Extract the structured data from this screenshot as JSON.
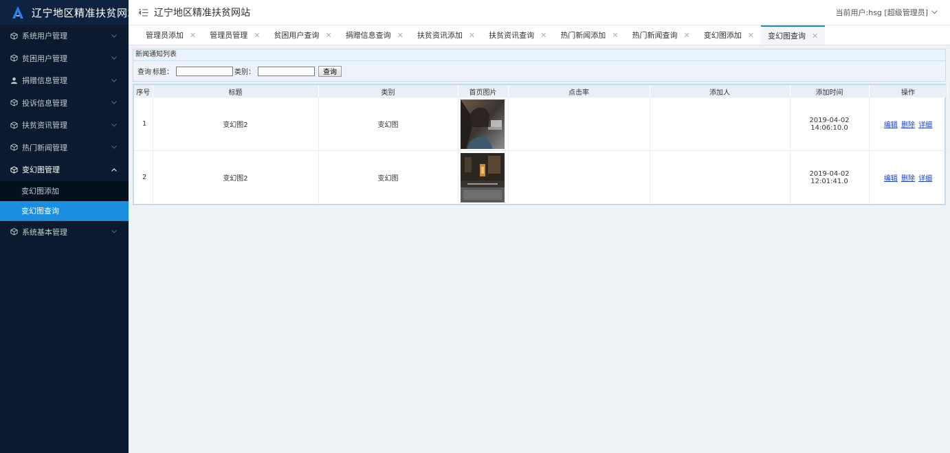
{
  "app": {
    "logo_text": "辽宁地区精准扶贫网站",
    "header_title": "辽宁地区精准扶贫网站",
    "user_info": "当前用户:hsg [超级管理员]"
  },
  "sidebar": {
    "items": [
      {
        "label": "系统用户管理",
        "icon": "cube-icon"
      },
      {
        "label": "贫困用户管理",
        "icon": "cube-icon"
      },
      {
        "label": "捐赠信息管理",
        "icon": "user-icon"
      },
      {
        "label": "投诉信息管理",
        "icon": "cube-icon"
      },
      {
        "label": "扶贫资讯管理",
        "icon": "cube-icon"
      },
      {
        "label": "热门新闻管理",
        "icon": "cube-icon"
      },
      {
        "label": "变幻图管理",
        "icon": "cube-icon",
        "open": true
      },
      {
        "label": "系统基本管理",
        "icon": "cube-icon"
      }
    ],
    "submenu": [
      {
        "label": "变幻图添加"
      },
      {
        "label": "变幻图查询"
      }
    ]
  },
  "tabs": [
    {
      "label": "管理员添加"
    },
    {
      "label": "管理员管理"
    },
    {
      "label": "贫困用户查询"
    },
    {
      "label": "捐赠信息查询"
    },
    {
      "label": "扶贫资讯添加"
    },
    {
      "label": "扶贫资讯查询"
    },
    {
      "label": "热门新闻添加"
    },
    {
      "label": "热门新闻查询"
    },
    {
      "label": "变幻图添加"
    },
    {
      "label": "变幻图查询"
    }
  ],
  "panel": {
    "title": "新闻通知列表",
    "query_label": "查询",
    "title_label": "标题：",
    "category_label": "类别：",
    "query_button": "查询",
    "title_value": "",
    "category_value": ""
  },
  "table": {
    "headers": [
      "序号",
      "标题",
      "类别",
      "首页图片",
      "点击率",
      "添加人",
      "添加时间",
      "操作"
    ],
    "rows": [
      {
        "no": "1",
        "title": "变幻图2",
        "category": "变幻图",
        "image": "thumbnail-1",
        "clicks": "",
        "adder": "",
        "time": "2019-04-02 14:06:10.0"
      },
      {
        "no": "2",
        "title": "变幻图2",
        "category": "变幻图",
        "image": "thumbnail-2",
        "clicks": "",
        "adder": "",
        "time": "2019-04-02 12:01:41.0"
      }
    ],
    "ops": {
      "edit": "编辑",
      "delete": "删除",
      "detail": "详细"
    }
  },
  "colors": {
    "sidebar_bg": "#0b1a2f",
    "active_sub": "#1b8ee0",
    "link": "#1a3ec7",
    "tab_active_border": "#1e8bc3"
  }
}
